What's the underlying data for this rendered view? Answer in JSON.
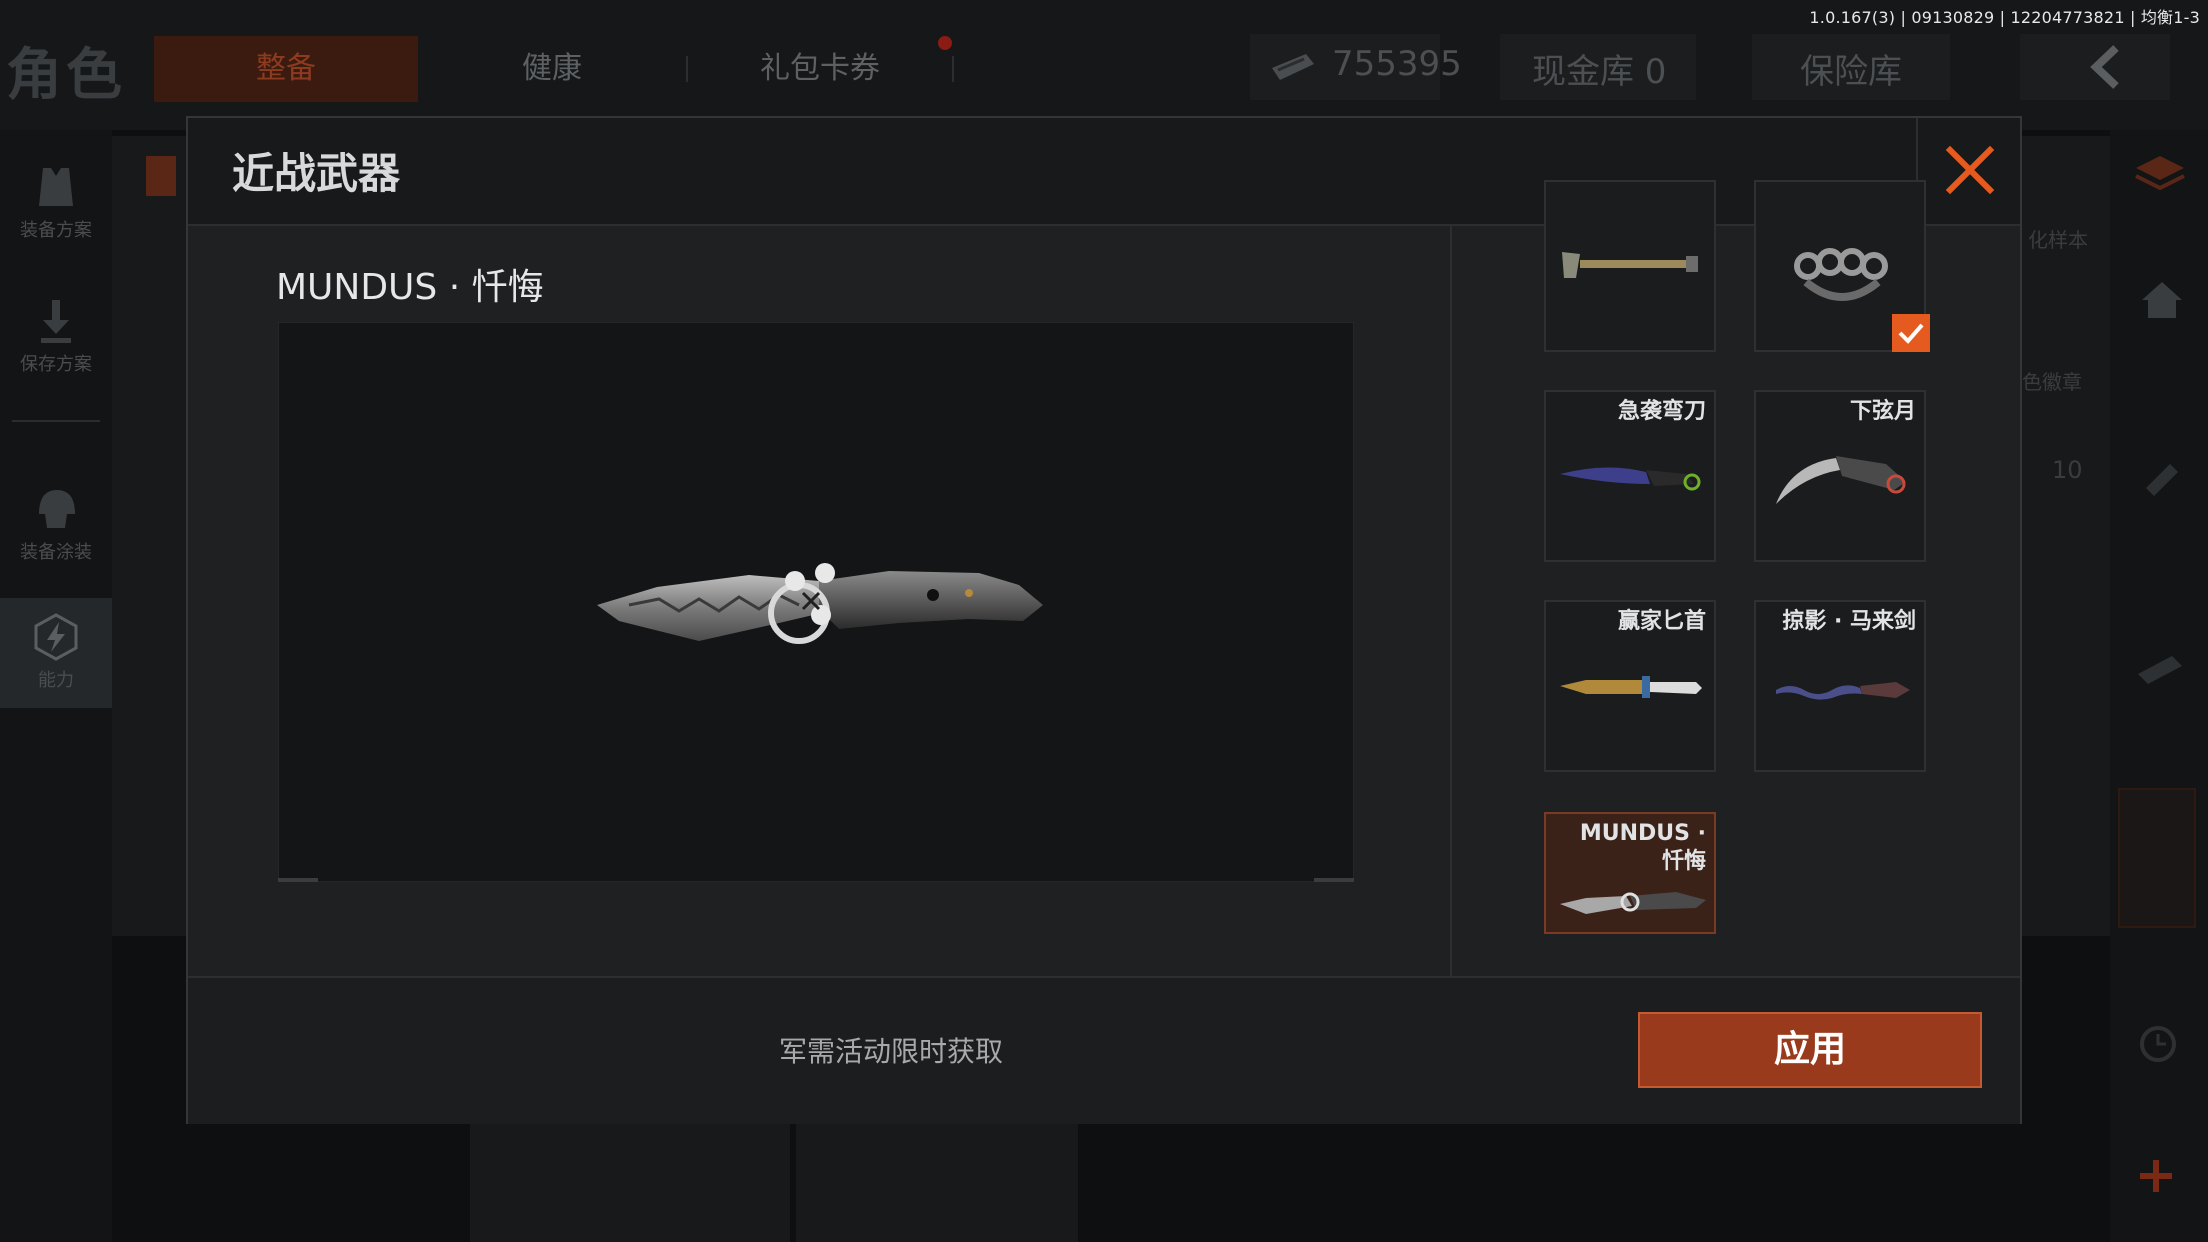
{
  "version_info": "1.0.167(3) | 09130829 | 12204773821 | 均衡1-3",
  "top_bar": {
    "page_title": "角色",
    "tabs": [
      {
        "label": "整备"
      },
      {
        "label": "健康"
      },
      {
        "label": "礼包卡券"
      }
    ],
    "currency_amount": "755395",
    "cash_vault": "现金库 0",
    "safe_box": "保险库"
  },
  "left_rail": {
    "items": [
      {
        "label": "装备方案",
        "icon": "armor-vest-icon"
      },
      {
        "label": "保存方案",
        "icon": "download-icon"
      },
      {
        "label": "装备涂装",
        "icon": "helmet-icon"
      },
      {
        "label": "能力",
        "icon": "lightning-icon"
      }
    ]
  },
  "background": {
    "partial_label_1": "化样本",
    "partial_label_2": "色徽章",
    "partial_value": "10"
  },
  "modal": {
    "title": "近战武器",
    "selected_weapon_name": "MUNDUS · 忏悔",
    "items": [
      {
        "label": "",
        "icon": "shovel-icon",
        "equipped": false,
        "selected": false
      },
      {
        "label": "",
        "icon": "knuckle-duster-icon",
        "equipped": true,
        "selected": false
      },
      {
        "label": "急袭弯刀",
        "icon": "curved-blade-icon",
        "equipped": false,
        "selected": false
      },
      {
        "label": "下弦月",
        "icon": "karambit-icon",
        "equipped": false,
        "selected": false
      },
      {
        "label": "赢家匕首",
        "icon": "dagger-icon",
        "equipped": false,
        "selected": false
      },
      {
        "label": "掠影 · 马来剑",
        "icon": "kris-sword-icon",
        "equipped": false,
        "selected": false
      },
      {
        "label_line1": "MUNDUS ·",
        "label_line2": "忏悔",
        "icon": "mundus-knife-icon",
        "equipped": false,
        "selected": true
      }
    ],
    "footer_hint": "军需活动限时获取",
    "apply_label": "应用"
  },
  "colors": {
    "accent": "#e55a1f",
    "apply_button": "#9a3a1c",
    "selected_item_bg": "#3b2219",
    "close_icon": "#e65a1e"
  }
}
